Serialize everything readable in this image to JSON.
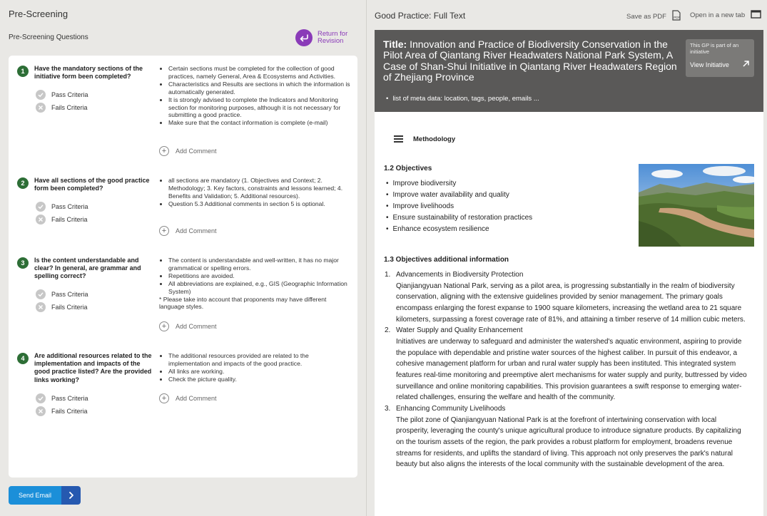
{
  "left": {
    "title": "Pre-Screening",
    "subtitle": "Pre-Screening Questions",
    "return_label": "Return for Revision",
    "pass_label": "Pass Criteria",
    "fail_label": "Fails Criteria",
    "add_comment_label": "Add Comment",
    "questions": [
      {
        "num": "1",
        "title": "Have the mandatory sections of the initiative form been completed?",
        "notes": [
          "Certain sections must be completed for the collection of good practices, namely General, Area & Ecosystems and Activities.",
          "Characteristics and Results  are sections in which the information is automatically generated.",
          "It is strongly advised to complete the Indicators and Monitoring section for monitoring purposes, although it is not necessary for submitting a good practice.",
          "Make sure that the contact information is complete (e-mail)"
        ],
        "extra": ""
      },
      {
        "num": "2",
        "title": "Have all sections of the good practice form been completed?",
        "notes": [
          "all sections are mandatory (1. Objectives and Context; 2. Methodology; 3. Key factors, constraints and lessons learned; 4. Benefits and Validation; 5. Additional resources).",
          "Question 5.3 Additional comments in section 5 is optional."
        ],
        "extra": ""
      },
      {
        "num": "3",
        "title": "Is the content understandable and clear? In general, are grammar and spelling correct?",
        "notes": [
          "The content is understandable and well-written, it has no major grammatical or spelling errors.",
          "Repetitions are avoided.",
          "All abbreviations are explained, e.g., GIS (Geographic Information System)"
        ],
        "extra": "* Please take into account that proponents may have different language styles."
      },
      {
        "num": "4",
        "title": "Are additional resources related to the implementation and impacts of the good practice listed? Are the provided links working?",
        "notes": [
          "The additional resources provided are related to the implementation and impacts of the good practice.",
          "All links are working.",
          "Check the picture quality."
        ],
        "extra": ""
      }
    ],
    "send_label": "Send Email"
  },
  "right": {
    "title": "Good Practice: Full Text",
    "save_pdf_label": "Save as PDF",
    "open_tab_label": "Open in a new tab",
    "doc_title_prefix": "Title:",
    "doc_title": "Innovation and Practice of Biodiversity Conservation in the Pilot Area of Qiantang River Headwaters National Park System, A Case of Shan-Shui Initiative in Qiantang River Headwaters Region of Zhejiang Province",
    "initiative_text": "This GP is part of an initiative",
    "initiative_link": "View Initiative",
    "meta": "list of meta data: location, tags, people, emails ...",
    "methodology_label": "Methodology",
    "objectives_heading": "1.2 Objectives",
    "objectives": [
      "Improve biodiversity",
      "Improve water availability and quality",
      "Improve livelihoods",
      "Ensure sustainability of restoration practices",
      "Enhance ecosystem resilience"
    ],
    "additional_heading": "1.3 Objectives additional information",
    "additional": [
      {
        "num": "1.",
        "title": "Advancements in Biodiversity Protection",
        "text": "Qianjiangyuan National Park, serving as a pilot area, is progressing substantially in the realm of biodiversity conservation, aligning with the extensive guidelines provided by senior management. The primary goals encompass enlarging the forest expanse to 1900 square kilometers, increasing the wetland area to 21 square kilometers, surpassing a forest coverage rate of 81%, and attaining a timber reserve of 14 million cubic meters."
      },
      {
        "num": "2.",
        "title": "Water Supply and Quality Enhancement",
        "text": "Initiatives are underway to safeguard and administer the watershed's aquatic environment, aspiring to provide the populace with dependable and pristine water sources of the highest caliber. In pursuit of this endeavor, a cohesive management platform for urban and rural water supply has been instituted. This integrated system features real-time monitoring and preemptive alert mechanisms for water supply and purity, buttressed by video surveillance and online monitoring capabilities. This provision guarantees a swift response to emerging water-related challenges, ensuring the welfare and health of the community."
      },
      {
        "num": "3.",
        "title": "Enhancing Community Livelihoods",
        "text": "The pilot zone of Qianjiangyuan National Park is at the forefront of intertwining conservation with local prosperity, leveraging the county's unique agricultural produce to introduce signature products. By capitalizing on the tourism assets of the region, the park provides a robust platform for employment, broadens revenue streams for residents, and uplifts the standard of living. This approach not only preserves the park's natural beauty but also aligns the interests of the local community with the sustainable development of the area."
      }
    ]
  }
}
